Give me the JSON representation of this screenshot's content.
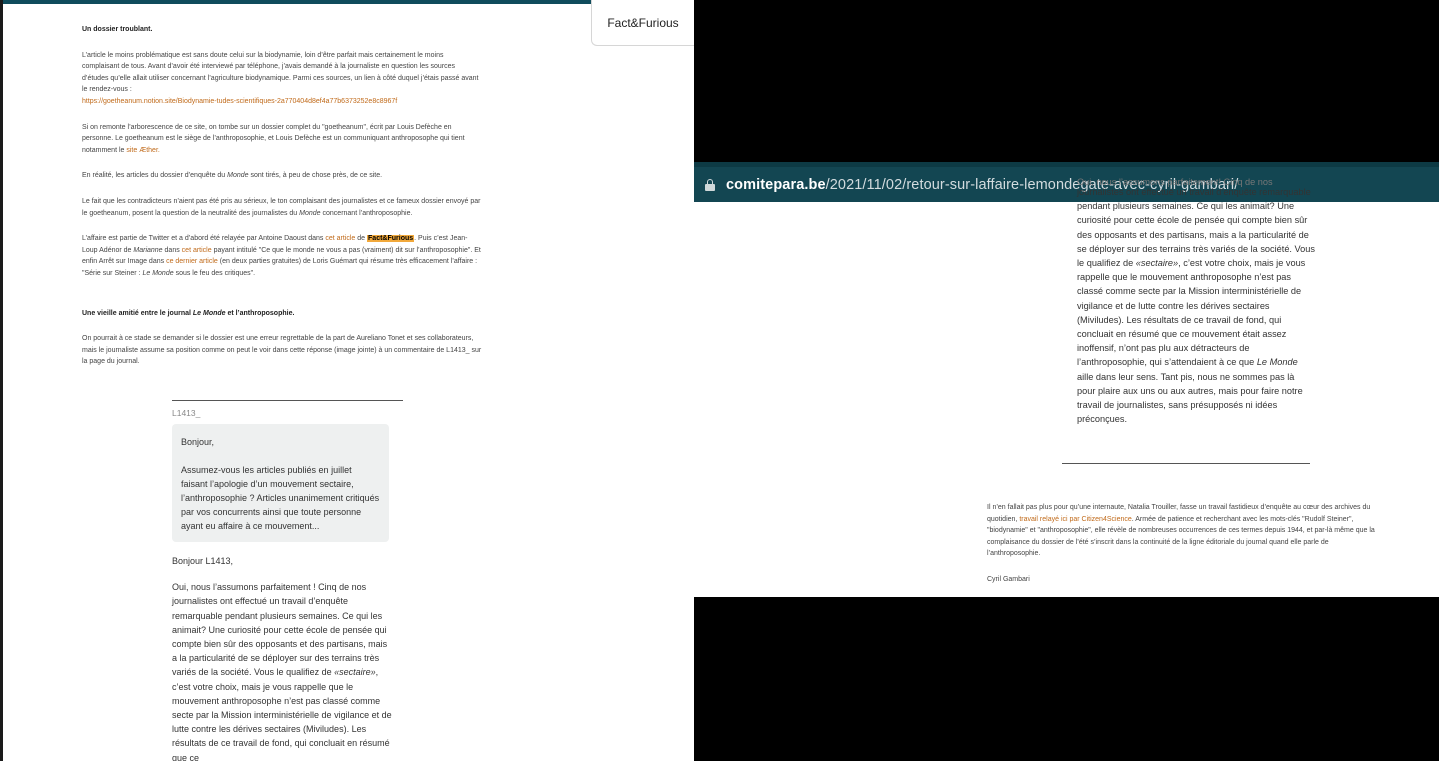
{
  "left_article": {
    "heading1": "Un dossier troublant.",
    "p1_text": "L’article le moins problématique est sans doute celui sur la biodynamie, loin d’être parfait mais certainement le moins complaisant de tous. Avant d’avoir été interviewé par téléphone, j’avais demandé à la journaliste en question les sources d’études qu’elle allait utiliser concernant l’agriculture biodynamique. Parmi ces sources, un lien à côté duquel j’étais passé avant le rendez-vous :",
    "p1_link": "https://goetheanum.notion.site/Biodynamie-tudes-scientifiques-2a770404d8ef4a77b6373252e8c8967f",
    "p2_text": "Si on remonte l’arborescence de ce site, on tombe sur un dossier complet du \"goetheanum\", écrit par Louis Defèche en personne. Le goetheanum est le siège de l’anthroposophie, et Louis Defèche est un communiquant anthroposophe qui tient notamment le",
    "p2_link": "site Æther.",
    "p3_a": "En réalité, les articles du dossier d’enquête du",
    "p3_italic": "Monde",
    "p3_b": "sont tirés, à peu de chose près, de ce site.",
    "p4_a": "Le fait que les contradicteurs n’aient pas été pris au sérieux, le ton complaisant des journalistes et ce fameux dossier envoyé par le goetheanum, posent la question de la neutralité des journalistes du",
    "p4_italic": "Monde",
    "p4_b": "concernant l’anthroposophie.",
    "p5_a": "L’affaire est partie de Twitter et a d’abord été relayée par Antoine Daoust dans",
    "p5_link1": "cet article",
    "p5_b": "de",
    "p5_highlight": "Fact&Furious",
    "p5_c": ". Puis c’est Jean-Loup Adénor de",
    "p5_italic1": "Marianne",
    "p5_d": "dans",
    "p5_link2": "cet article",
    "p5_e": "payant intitulé \"Ce que le monde ne vous a pas (vraiment) dit sur l’anthroposophie\". Et enfin Arrêt sur Image dans",
    "p5_link3": "ce dernier article",
    "p5_f": "(en deux parties gratuites) de Loris Guémart qui résume très efficacement l’affaire : \"Série sur Steiner :",
    "p5_italic2": "Le Monde",
    "p5_g": "sous le feu des critiques\".",
    "heading2_a": "Une vieille amitié entre le journal",
    "heading2_italic": "Le Monde",
    "heading2_b": "et l’anthroposophie.",
    "p6": "On pourrait à ce stade se demander si le dossier est une erreur regrettable de la part de Aureliano Tonet et ses collaborateurs, mais le journaliste assume sa position comme on peut le voir dans cette réponse (image jointe) à un commentaire de L1413_ sur la page du journal."
  },
  "comment": {
    "user": "L1413_",
    "question_greeting": "Bonjour,",
    "question_body": "Assumez-vous les articles publiés en juillet faisant l’apologie d’un mouvement sectaire, l’anthroposophie ? Articles unanimement critiqués par vos concurrents ainsi que toute personne ayant eu affaire à ce mouvement...",
    "reply_greeting": "Bonjour L1413,",
    "reply_body_a": "Oui, nous l’assumons parfaitement ! Cinq de nos journalistes ont effectué un travail d’enquête remarquable pendant plusieurs semaines. Ce qui les animait? Une curiosité pour cette école de pensée qui compte bien sûr des opposants et des partisans, mais a la particularité de se déployer sur des terrains très variés de la société. Vous le qualifiez de",
    "reply_quote": "«sectaire»",
    "reply_body_b": ", c’est votre choix, mais je vous rappelle que le mouvement anthroposophe n’est pas classé comme secte par la Mission interministérielle de vigilance et de lutte contre les dérives sectaires (Miviludes). Les résultats de ce travail de fond, qui concluait en résumé que ce",
    "reply_cut_line": "Oui, nous l’assumons parfaitement! Cinq de nos",
    "reply_right_a": "journalistes ont effectué un travail d’enquête remarquable pendant plusieurs semaines. Ce qui les animait? Une curiosité pour cette école de pensée qui compte bien sûr des opposants et des partisans, mais a la particularité de se déployer sur des terrains très variés de la société. Vous le qualifiez de",
    "reply_right_b": ", c’est votre choix, mais je vous rappelle que le mouvement anthroposophe n’est pas classé comme secte par la Mission interministérielle de vigilance et de lutte contre les dérives sectaires (Miviludes). Les résultats de ce travail de fond, qui concluait en résumé que ce mouvement était assez inoffensif, n’ont pas plu aux détracteurs de l’anthroposophie, qui s’attendaient à ce que",
    "reply_right_italic": "Le Monde",
    "reply_right_c": "aille dans leur sens. Tant pis, nous ne sommes pas là pour plaire aux uns ou aux autres, mais pour faire notre travail de journalistes, sans présupposés ni idées préconçues."
  },
  "fact_tab": {
    "label": "Fact&Furious"
  },
  "browser": {
    "url_domain": "comitepara.be",
    "url_path": "/2021/11/02/retour-sur-laffaire-lemondegate-avec-cyril-gambari/"
  },
  "right_article": {
    "p1_a": "Il n’en fallait pas plus pour qu’une internaute, Natalia Trouiller, fasse un travail fastidieux d’enquête au cœur des archives du quotidien,",
    "p1_link": "travail relayé ici par Citizen4Science",
    "p1_b": ". Armée de patience et recherchant avec les mots-clés \"Rudolf Steiner\", \"biodynamie\" et \"anthroposophie\", elle révèle de nombreuses occurrences de ces termes depuis 1944, et par-là même que la complaisance du dossier de l’été s’inscrit dans la continuité de la ligne éditoriale du journal quand elle parle de l’anthroposophie.",
    "signature": "Cyril Gambari"
  },
  "colors": {
    "url_bar": "#134652",
    "link": "#c06a1a",
    "highlight": "#f2a93b",
    "top_bar": "#0f4c5c"
  }
}
